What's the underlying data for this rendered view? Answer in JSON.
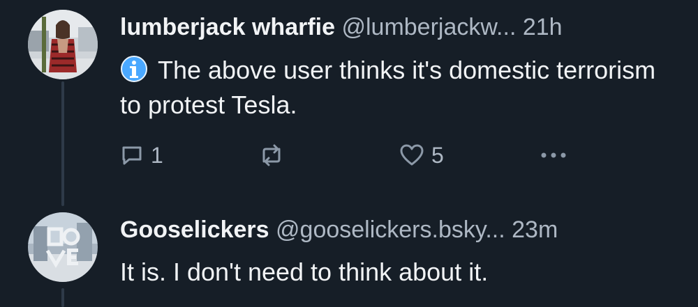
{
  "posts": [
    {
      "display_name": "lumberjack wharfie",
      "handle": "@lumberjackw...",
      "time": "21h",
      "badge_icon": "info-icon",
      "text": "The above user thinks it's domestic terrorism to protest Tesla.",
      "reply_count": "1",
      "like_count": "5"
    },
    {
      "display_name": "Gooselickers",
      "handle": "@gooselickers.bsky...",
      "time": "23m",
      "text": "It is. I don't need to think about it."
    }
  ],
  "colors": {
    "background": "#161e27",
    "primary_text": "#f1f3f5",
    "secondary_text": "#aeb8c4",
    "icon": "#8c99a8",
    "info_badge": "#4aa8ff",
    "thread_line": "#2e3a48"
  }
}
